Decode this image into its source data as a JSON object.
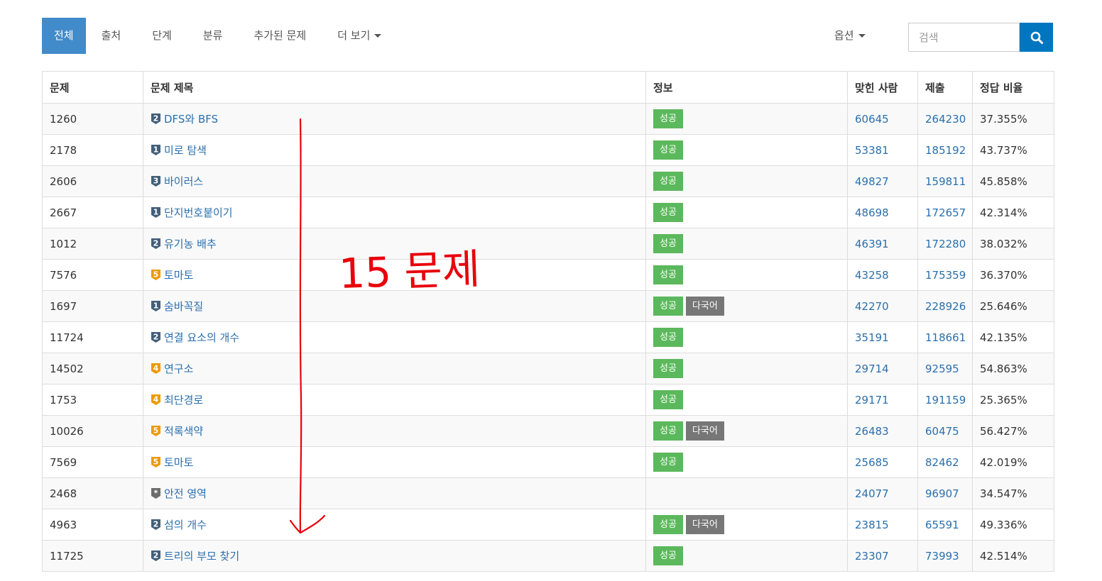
{
  "nav": {
    "items": [
      {
        "label": "전체",
        "active": true
      },
      {
        "label": "출처",
        "active": false
      },
      {
        "label": "단계",
        "active": false
      },
      {
        "label": "분류",
        "active": false
      },
      {
        "label": "추가된 문제",
        "active": false
      },
      {
        "label": "더 보기",
        "active": false,
        "dropdown": true
      }
    ],
    "options_label": "옵션"
  },
  "search": {
    "placeholder": "검색",
    "button_icon": "search-icon"
  },
  "colors": {
    "accent": "#428bca",
    "link": "#2a6fad",
    "success": "#5cb85c",
    "lang": "#777777",
    "annotation": "#e8000b",
    "tier_silver": "#435f7a",
    "tier_gold": "#ec9a00",
    "tier_unrated": "#6d6d6d"
  },
  "table": {
    "headers": [
      "문제",
      "문제 제목",
      "정보",
      "맞힌 사람",
      "제출",
      "정답 비율"
    ],
    "rows": [
      {
        "id": "1260",
        "tier": "silver",
        "level": "2",
        "title": "DFS와 BFS",
        "labels": [
          "성공"
        ],
        "solved": "60645",
        "submissions": "264230",
        "ratio": "37.355%"
      },
      {
        "id": "2178",
        "tier": "silver",
        "level": "1",
        "title": "미로 탐색",
        "labels": [
          "성공"
        ],
        "solved": "53381",
        "submissions": "185192",
        "ratio": "43.737%"
      },
      {
        "id": "2606",
        "tier": "silver",
        "level": "3",
        "title": "바이러스",
        "labels": [
          "성공"
        ],
        "solved": "49827",
        "submissions": "159811",
        "ratio": "45.858%"
      },
      {
        "id": "2667",
        "tier": "silver",
        "level": "1",
        "title": "단지번호붙이기",
        "labels": [
          "성공"
        ],
        "solved": "48698",
        "submissions": "172657",
        "ratio": "42.314%"
      },
      {
        "id": "1012",
        "tier": "silver",
        "level": "2",
        "title": "유기농 배추",
        "labels": [
          "성공"
        ],
        "solved": "46391",
        "submissions": "172280",
        "ratio": "38.032%"
      },
      {
        "id": "7576",
        "tier": "gold",
        "level": "5",
        "title": "토마토",
        "labels": [
          "성공"
        ],
        "solved": "43258",
        "submissions": "175359",
        "ratio": "36.370%"
      },
      {
        "id": "1697",
        "tier": "silver",
        "level": "1",
        "title": "숨바꼭질",
        "labels": [
          "성공",
          "다국어"
        ],
        "solved": "42270",
        "submissions": "228926",
        "ratio": "25.646%"
      },
      {
        "id": "11724",
        "tier": "silver",
        "level": "2",
        "title": "연결 요소의 개수",
        "labels": [
          "성공"
        ],
        "solved": "35191",
        "submissions": "118661",
        "ratio": "42.135%"
      },
      {
        "id": "14502",
        "tier": "gold",
        "level": "4",
        "title": "연구소",
        "labels": [
          "성공"
        ],
        "solved": "29714",
        "submissions": "92595",
        "ratio": "54.863%"
      },
      {
        "id": "1753",
        "tier": "gold",
        "level": "4",
        "title": "최단경로",
        "labels": [
          "성공"
        ],
        "solved": "29171",
        "submissions": "191159",
        "ratio": "25.365%"
      },
      {
        "id": "10026",
        "tier": "gold",
        "level": "5",
        "title": "적록색약",
        "labels": [
          "성공",
          "다국어"
        ],
        "solved": "26483",
        "submissions": "60475",
        "ratio": "56.427%"
      },
      {
        "id": "7569",
        "tier": "gold",
        "level": "5",
        "title": "토마토",
        "labels": [
          "성공"
        ],
        "solved": "25685",
        "submissions": "82462",
        "ratio": "42.019%"
      },
      {
        "id": "2468",
        "tier": "unrated",
        "level": "*",
        "title": "안전 영역",
        "labels": [],
        "solved": "24077",
        "submissions": "96907",
        "ratio": "34.547%"
      },
      {
        "id": "4963",
        "tier": "silver",
        "level": "2",
        "title": "섬의 개수",
        "labels": [
          "성공",
          "다국어"
        ],
        "solved": "23815",
        "submissions": "65591",
        "ratio": "49.336%"
      },
      {
        "id": "11725",
        "tier": "silver",
        "level": "2",
        "title": "트리의 부모 찾기",
        "labels": [
          "성공"
        ],
        "solved": "23307",
        "submissions": "73993",
        "ratio": "42.514%"
      }
    ]
  },
  "annotation": {
    "text": "15 문제"
  }
}
